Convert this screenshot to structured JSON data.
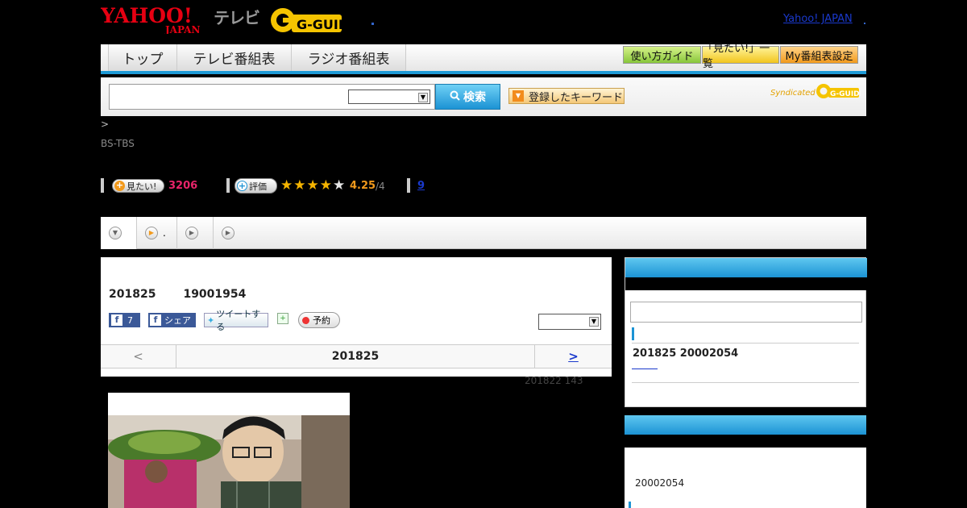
{
  "header": {
    "yahoo_logo_line1": "YAHOO!",
    "yahoo_logo_line2": "JAPAN",
    "tv_label": "テレビ",
    "gguide_logo": "G-GUIDE",
    "yahoo_japan_link": "Yahoo! JAPAN"
  },
  "nav": {
    "tabs": [
      {
        "label": "トップ"
      },
      {
        "label": "テレビ番組表"
      },
      {
        "label": "ラジオ番組表"
      }
    ],
    "buttons": [
      {
        "label": "使い方ガイド"
      },
      {
        "label": "「見たい!」一覧"
      },
      {
        "label": "My番組表設定"
      }
    ]
  },
  "search": {
    "input_value": "",
    "select_value": "",
    "button_label": "検索",
    "keyword_button_label": "登録したキーワード",
    "syndicated_label": "Syndicated",
    "gguide_small": "G-GUIDE"
  },
  "breadcrumb": ">",
  "channel": "BS-TBS",
  "stats": {
    "want_label": "見たい!",
    "want_count": "3206",
    "rate_label": "評価",
    "rating_value": 4.25,
    "rating_text": "4.25",
    "rating_max_text": "/4",
    "comments_count": "9"
  },
  "subnav": {
    "items": [
      {
        "label": ""
      },
      {
        "label": "."
      },
      {
        "label": ""
      },
      {
        "label": ""
      }
    ]
  },
  "program": {
    "date": "201825",
    "time": "19001954",
    "fb_like_count": "7",
    "fb_share_label": "シェア",
    "tweet_label": "ツイートする",
    "reserve_label": "予約",
    "select_value": "",
    "prev_label": "<",
    "current_date": "201825",
    "next_label": ">",
    "updated": "201822  143"
  },
  "sidebar": {
    "box1": {
      "datetime": "201825  20002054"
    },
    "box2": {
      "time": "20002054"
    }
  },
  "colors": {
    "accent_blue": "#1c93d4",
    "pink_count": "#e8246a",
    "rating_orange": "#f29a1c",
    "link_blue": "#1a39cc"
  }
}
